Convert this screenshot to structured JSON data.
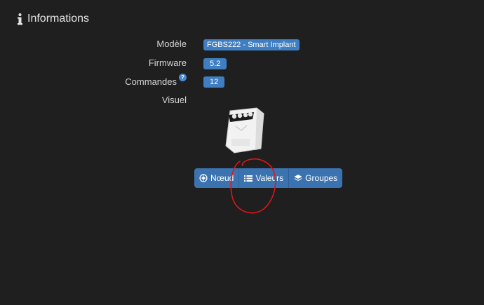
{
  "section": {
    "title": "Informations",
    "icon": "info-icon"
  },
  "info_rows": [
    {
      "label": "Modèle",
      "value": "FGBS222 - Smart Implant"
    },
    {
      "label": "Firmware",
      "value": "5.2"
    },
    {
      "label": "Commandes",
      "value": "12",
      "help_icon": "question-circle-icon"
    },
    {
      "label": "Visuel"
    }
  ],
  "buttons": [
    {
      "label": "Nœud",
      "icon": "network-icon"
    },
    {
      "label": "Valeurs",
      "icon": "list-icon"
    },
    {
      "label": "Groupes",
      "icon": "layers-icon"
    }
  ],
  "colors": {
    "background": "#1f1f1f",
    "badge": "#3f7ec2",
    "button": "#3a73b0",
    "annotation": "#e0141a"
  }
}
